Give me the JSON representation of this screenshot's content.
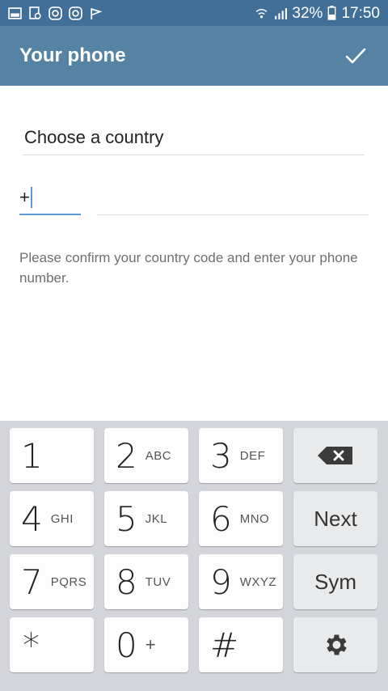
{
  "status_bar": {
    "battery": "32%",
    "time": "17:50",
    "icons": [
      "gallery-icon",
      "document-icon",
      "instagram-icon",
      "instagram-icon",
      "flag-icon",
      "wifi-icon",
      "signal-icon",
      "battery-icon"
    ]
  },
  "app_bar": {
    "title": "Your phone",
    "confirm_icon": "checkmark-icon"
  },
  "form": {
    "country_value": "Choose a country",
    "code_value": "+",
    "phone_value": "",
    "hint": "Please confirm your country code and enter your phone number."
  },
  "keyboard": {
    "rows": [
      [
        {
          "main": "1",
          "sub": ""
        },
        {
          "main": "2",
          "sub": "ABC"
        },
        {
          "main": "3",
          "sub": "DEF"
        },
        {
          "icon": "backspace-icon"
        }
      ],
      [
        {
          "main": "4",
          "sub": "GHI"
        },
        {
          "main": "5",
          "sub": "JKL"
        },
        {
          "main": "6",
          "sub": "MNO"
        },
        {
          "label": "Next"
        }
      ],
      [
        {
          "main": "7",
          "sub": "PQRS"
        },
        {
          "main": "8",
          "sub": "TUV"
        },
        {
          "main": "9",
          "sub": "WXYZ"
        },
        {
          "label": "Sym"
        }
      ],
      [
        {
          "main": "*",
          "sub": ""
        },
        {
          "main": "0",
          "sub": "+"
        },
        {
          "main": "#",
          "sub": ""
        },
        {
          "icon": "gear-icon"
        }
      ]
    ]
  },
  "colors": {
    "status_bar": "#416f97",
    "app_bar": "#5682a3",
    "accent": "#5b9bd8",
    "keyboard_bg": "#d3d5da"
  }
}
